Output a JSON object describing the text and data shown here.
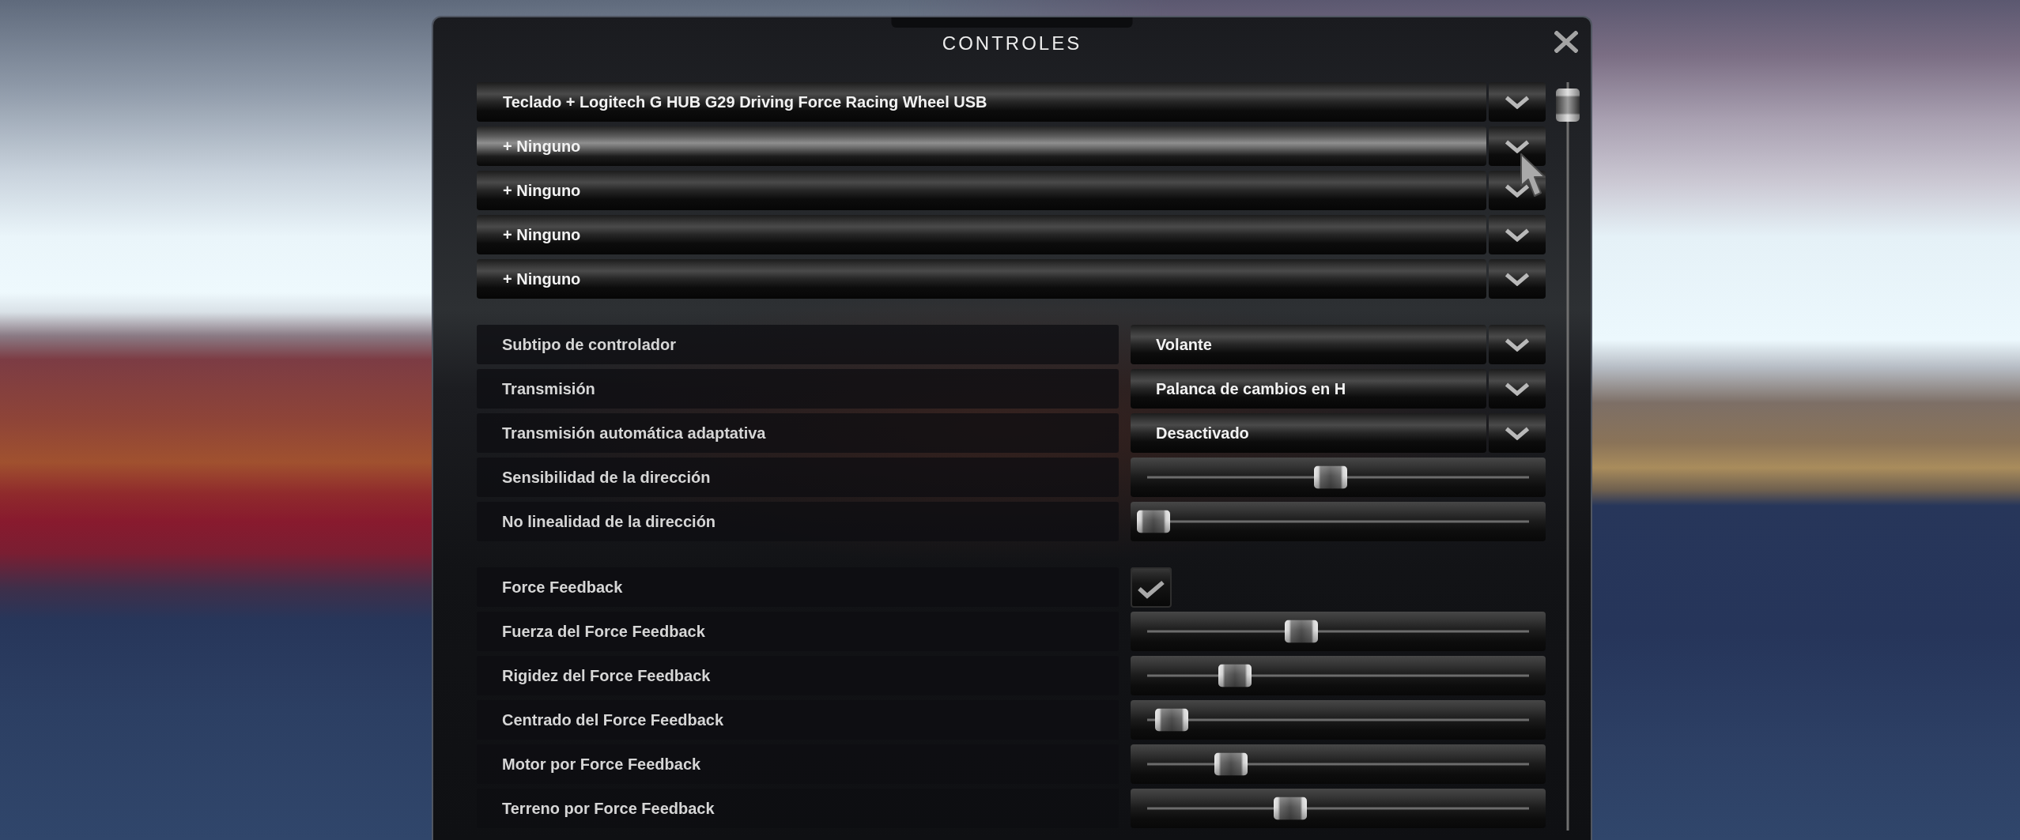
{
  "window": {
    "title": "CONTROLES"
  },
  "device_slots": [
    {
      "label": "Teclado + Logitech G HUB G29 Driving Force Racing Wheel USB",
      "highlighted": false
    },
    {
      "label": "+ Ninguno",
      "highlighted": true
    },
    {
      "label": "+ Ninguno",
      "highlighted": false
    },
    {
      "label": "+ Ninguno",
      "highlighted": false
    },
    {
      "label": "+ Ninguno",
      "highlighted": false
    }
  ],
  "settings_groups": [
    {
      "rows": [
        {
          "label": "Subtipo de controlador",
          "kind": "dropdown",
          "value": "Volante"
        },
        {
          "label": "Transmisión",
          "kind": "dropdown",
          "value": "Palanca de cambios en H"
        },
        {
          "label": "Transmisión automática adaptativa",
          "kind": "dropdown",
          "value": "Desactivado"
        },
        {
          "label": "Sensibilidad de la dirección",
          "kind": "slider",
          "level": 0.48
        },
        {
          "label": "No linealidad de la dirección",
          "kind": "slider",
          "level": 0
        }
      ]
    },
    {
      "rows": [
        {
          "label": "Force Feedback",
          "kind": "checkbox",
          "checked": true
        },
        {
          "label": "Fuerza del Force Feedback",
          "kind": "slider",
          "level": 0.4
        },
        {
          "label": "Rigidez del Force Feedback",
          "kind": "slider",
          "level": 0.22
        },
        {
          "label": "Centrado del Force Feedback",
          "kind": "slider",
          "level": 0.05
        },
        {
          "label": "Motor por Force Feedback",
          "kind": "slider",
          "level": 0.21
        },
        {
          "label": "Terreno por Force Feedback",
          "kind": "slider",
          "level": 0.37
        }
      ]
    }
  ]
}
